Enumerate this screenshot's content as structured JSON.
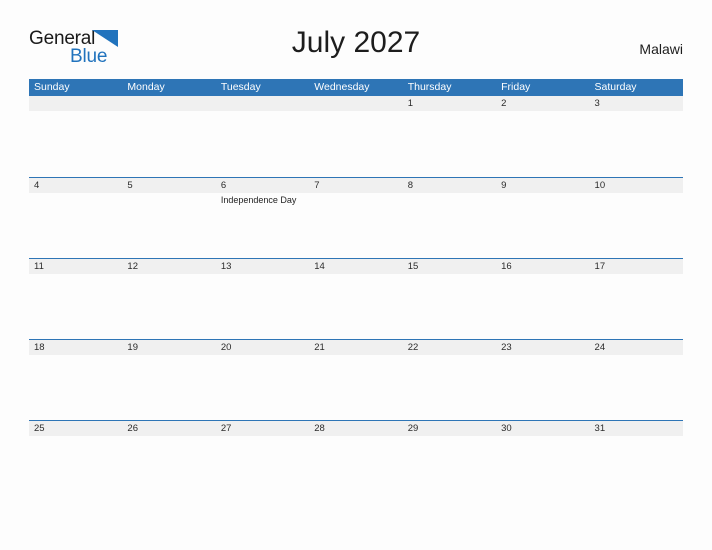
{
  "brand": {
    "name_part1": "General",
    "name_part2": "Blue",
    "flag_icon": "blue-triangle-flag-icon",
    "accent_color": "#2173bd"
  },
  "header": {
    "title": "July 2027",
    "country": "Malawi"
  },
  "theme": {
    "header_blue": "#2e75b6",
    "band_gray": "#f0f0f0",
    "page_background": "#fdfdfd",
    "text_color": "#2b2b2b"
  },
  "calendar": {
    "weekday_headers": [
      "Sunday",
      "Monday",
      "Tuesday",
      "Wednesday",
      "Thursday",
      "Friday",
      "Saturday"
    ],
    "weeks": [
      {
        "days": [
          {
            "num": "",
            "events": []
          },
          {
            "num": "",
            "events": []
          },
          {
            "num": "",
            "events": []
          },
          {
            "num": "",
            "events": []
          },
          {
            "num": "1",
            "events": []
          },
          {
            "num": "2",
            "events": []
          },
          {
            "num": "3",
            "events": []
          }
        ]
      },
      {
        "days": [
          {
            "num": "4",
            "events": []
          },
          {
            "num": "5",
            "events": []
          },
          {
            "num": "6",
            "events": [
              "Independence Day"
            ]
          },
          {
            "num": "7",
            "events": []
          },
          {
            "num": "8",
            "events": []
          },
          {
            "num": "9",
            "events": []
          },
          {
            "num": "10",
            "events": []
          }
        ]
      },
      {
        "days": [
          {
            "num": "11",
            "events": []
          },
          {
            "num": "12",
            "events": []
          },
          {
            "num": "13",
            "events": []
          },
          {
            "num": "14",
            "events": []
          },
          {
            "num": "15",
            "events": []
          },
          {
            "num": "16",
            "events": []
          },
          {
            "num": "17",
            "events": []
          }
        ]
      },
      {
        "days": [
          {
            "num": "18",
            "events": []
          },
          {
            "num": "19",
            "events": []
          },
          {
            "num": "20",
            "events": []
          },
          {
            "num": "21",
            "events": []
          },
          {
            "num": "22",
            "events": []
          },
          {
            "num": "23",
            "events": []
          },
          {
            "num": "24",
            "events": []
          }
        ]
      },
      {
        "days": [
          {
            "num": "25",
            "events": []
          },
          {
            "num": "26",
            "events": []
          },
          {
            "num": "27",
            "events": []
          },
          {
            "num": "28",
            "events": []
          },
          {
            "num": "29",
            "events": []
          },
          {
            "num": "30",
            "events": []
          },
          {
            "num": "31",
            "events": []
          }
        ]
      }
    ]
  }
}
